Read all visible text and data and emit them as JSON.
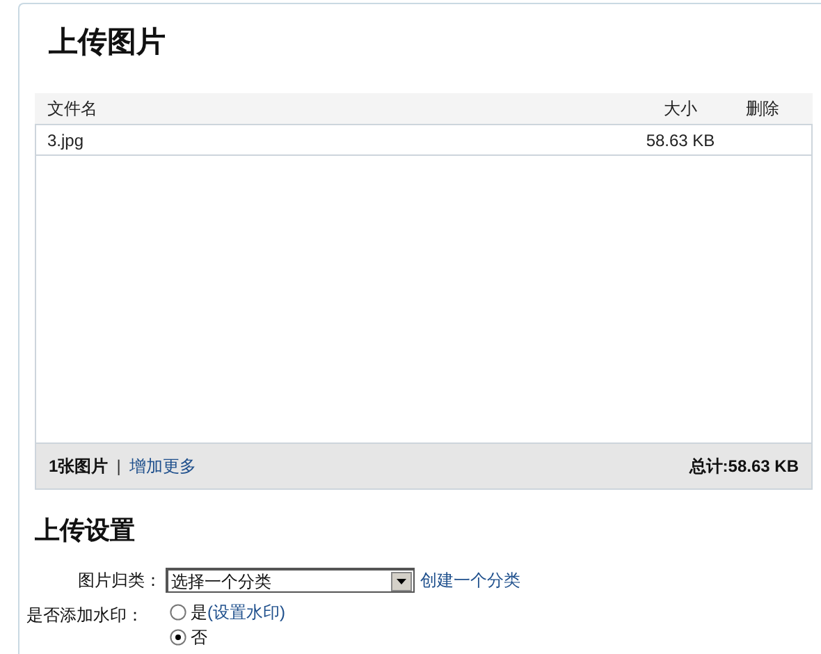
{
  "title": "上传图片",
  "table": {
    "columns": [
      {
        "label": "文件名"
      },
      {
        "label": "大小"
      },
      {
        "label": "删除"
      }
    ],
    "rows": [
      {
        "name": "3.jpg",
        "size": "58.63 KB"
      }
    ],
    "footer": {
      "count": "1张图片",
      "separator": "|",
      "add_more": "增加更多",
      "total": "总计:58.63 KB"
    }
  },
  "settings": {
    "title": "上传设置",
    "category": {
      "label": "图片归类：",
      "value": "选择一个分类",
      "create_link": "创建一个分类"
    },
    "watermark": {
      "label": "是否添加水印：",
      "options": [
        {
          "label": "是",
          "link": "(设置水印)",
          "selected": false
        },
        {
          "label": "否",
          "selected": true
        }
      ]
    }
  }
}
